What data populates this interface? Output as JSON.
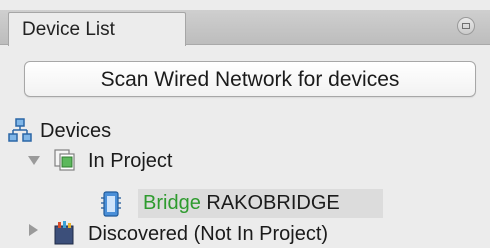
{
  "panel": {
    "tab_label": "Device List",
    "menu_icon": "panel-menu-icon"
  },
  "scan_button": {
    "label": "Scan Wired Network for devices"
  },
  "tree": {
    "root": {
      "label": "Devices",
      "icon": "network-icon"
    },
    "in_project": {
      "label": "In Project",
      "icon": "project-icon",
      "expanded": true
    },
    "bridge": {
      "name": "Bridge",
      "id": "RAKOBRIDGE",
      "icon": "bridge-device-icon",
      "name_color": "#2e9b2e",
      "selected": true
    },
    "discovered": {
      "label": "Discovered (Not In Project)",
      "icon": "discovered-icon",
      "expanded": false
    }
  }
}
